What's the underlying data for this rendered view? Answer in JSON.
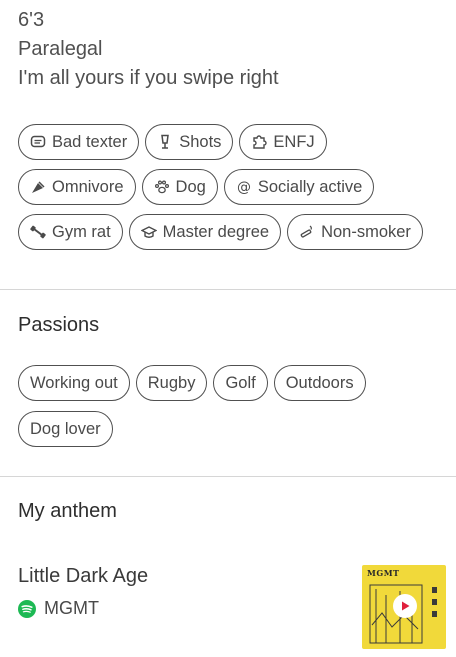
{
  "profile": {
    "height": "6'3",
    "job": "Paralegal",
    "bio": "I'm all yours if you swipe right"
  },
  "lifestyle": {
    "rows": [
      [
        {
          "label": "Bad texter",
          "icon": "chat-bubble-icon"
        },
        {
          "label": "Shots",
          "icon": "shot-glass-icon"
        },
        {
          "label": "ENFJ",
          "icon": "puzzle-icon"
        }
      ],
      [
        {
          "label": "Omnivore",
          "icon": "food-icon"
        },
        {
          "label": "Dog",
          "icon": "paw-icon"
        },
        {
          "label": "Socially active",
          "icon": "at-icon"
        }
      ],
      [
        {
          "label": "Gym rat",
          "icon": "dumbbell-icon"
        },
        {
          "label": "Master degree",
          "icon": "graduation-cap-icon"
        },
        {
          "label": "Non-smoker",
          "icon": "no-smoking-icon"
        }
      ]
    ]
  },
  "passions": {
    "title": "Passions",
    "rows": [
      [
        "Working out",
        "Rugby",
        "Golf",
        "Outdoors"
      ],
      [
        "Dog lover"
      ]
    ]
  },
  "anthem": {
    "title": "My anthem",
    "song": "Little Dark Age",
    "artist": "MGMT",
    "album_text": "MGMT",
    "spotify_color": "#1DB954",
    "album_color": "#f1d93a",
    "play_color": "#e0203c"
  }
}
